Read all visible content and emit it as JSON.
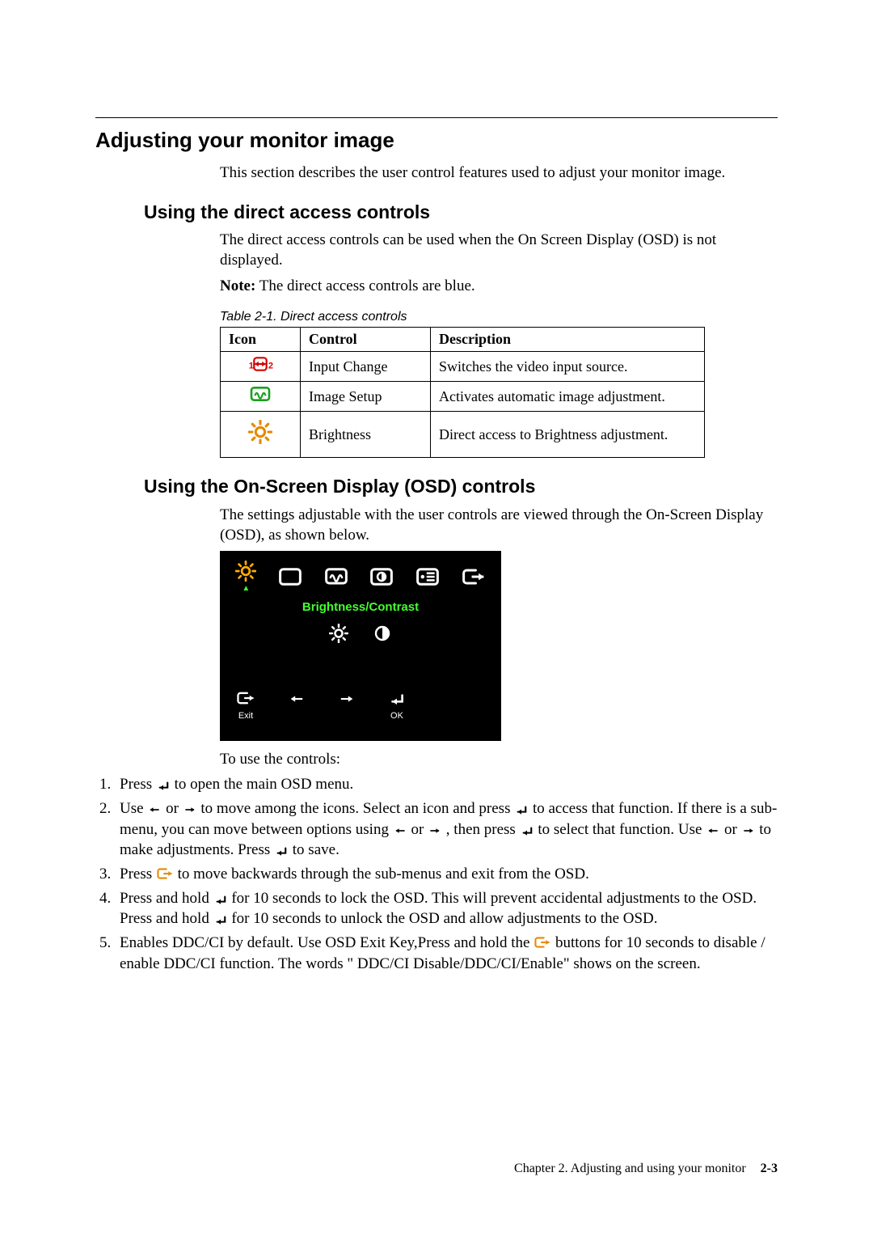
{
  "headings": {
    "h1": "Adjusting your monitor image",
    "h2a": "Using the direct access controls",
    "h2b": "Using the On-Screen Display (OSD) controls"
  },
  "paras": {
    "intro": "This section describes the user control features used to adjust your monitor image.",
    "direct_intro": "The direct access controls can be used when the On Screen Display (OSD) is not displayed.",
    "note_label": "Note:",
    "note_text": " The direct access controls are blue.",
    "table_caption": "Table 2-1. Direct access controls",
    "osd_intro": "The settings adjustable with the user controls are viewed through the On-Screen Display (OSD), as shown below.",
    "controls_lead": "To use the controls:"
  },
  "table": {
    "headers": {
      "icon": "Icon",
      "control": "Control",
      "desc": "Description"
    },
    "rows": [
      {
        "icon": "input-change-icon",
        "control": "Input Change",
        "desc": "Switches the video input source."
      },
      {
        "icon": "image-setup-icon",
        "control": "Image Setup",
        "desc": "Activates automatic image adjustment."
      },
      {
        "icon": "brightness-icon",
        "control": "Brightness",
        "desc": "Direct access to Brightness adjustment."
      }
    ]
  },
  "osd": {
    "title": "Brightness/Contrast",
    "exit": "Exit",
    "ok": "OK"
  },
  "steps": {
    "s1a": "Press ",
    "s1b": " to open the main OSD menu.",
    "s2a": "Use ",
    "s2b": " or ",
    "s2c": " to move among the icons. Select an icon and press ",
    "s2d": " to access that function. If there is a sub-menu, you can move between options using ",
    "s2e": " or ",
    "s2f": " , then press ",
    "s2g": " to select that function. Use ",
    "s2h": " or ",
    "s2i": " to make adjustments. Press ",
    "s2j": " to save.",
    "s3a": "Press ",
    "s3b": " to move backwards through the sub-menus and exit from the OSD.",
    "s4a": "Press and hold ",
    "s4b": " for 10 seconds to lock the OSD. This will prevent accidental adjustments to the OSD. Press and hold ",
    "s4c": " for 10 seconds to unlock the OSD and allow adjustments to the OSD.",
    "s5a": "Enables DDC/CI by default. Use OSD Exit Key,Press and hold the ",
    "s5b": " buttons for 10 seconds to disable / enable DDC/CI function. The words \" DDC/CI Disable/DDC/CI/Enable\" shows on the screen."
  },
  "footer": {
    "chapter": "Chapter 2. Adjusting and using your monitor",
    "page": "2-3"
  }
}
